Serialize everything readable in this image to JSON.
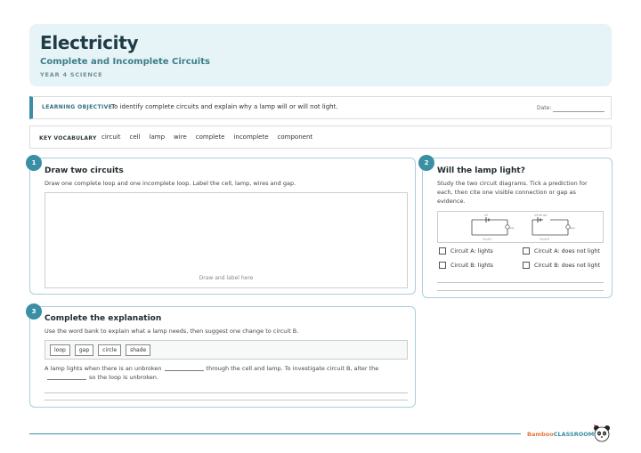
{
  "header": {
    "title": "Electricity",
    "subtitle": "Complete and Incomplete Circuits",
    "year": "YEAR 4 SCIENCE"
  },
  "objective": {
    "label": "LEARNING OBJECTIVE:",
    "text": "To identify complete circuits and explain why a lamp will or will not light.",
    "date_label": "Date:"
  },
  "vocabulary": {
    "label": "KEY VOCABULARY",
    "words": [
      "circuit",
      "cell",
      "lamp",
      "wire",
      "complete",
      "incomplete",
      "component"
    ]
  },
  "task1": {
    "number": "1",
    "title": "Draw two circuits",
    "instruction": "Draw one complete loop and one incomplete loop. Label the cell, lamp, wires and gap.",
    "hint": "Draw and label here"
  },
  "task2": {
    "number": "2",
    "title": "Will the lamp light?",
    "instruction": "Study the two circuit diagrams. Tick a prediction for each, then cite one visible connection or gap as evidence.",
    "diagram_a_top": "cell",
    "diagram_a_right": "lamp",
    "diagram_a_label": "Circuit A",
    "diagram_b_top": "cell with gap",
    "diagram_b_right": "lamp",
    "diagram_b_label": "Circuit B",
    "options": [
      "Circuit A: lights",
      "Circuit A: does not light",
      "Circuit B: lights",
      "Circuit B: does not light"
    ]
  },
  "task3": {
    "number": "3",
    "title": "Complete the explanation",
    "instruction": "Use the word bank to explain what a lamp needs, then suggest one change to circuit B.",
    "word_bank": [
      "loop",
      "gap",
      "circle",
      "shade"
    ],
    "sentence_part1": "A lamp lights when there is an unbroken",
    "sentence_part2": "through the cell and lamp. To investigate circuit B, alter the",
    "sentence_part3": "so the loop is unbroken."
  },
  "footer": {
    "brand_part1": "Bamboo",
    "brand_part2": "CLASSROOM"
  }
}
